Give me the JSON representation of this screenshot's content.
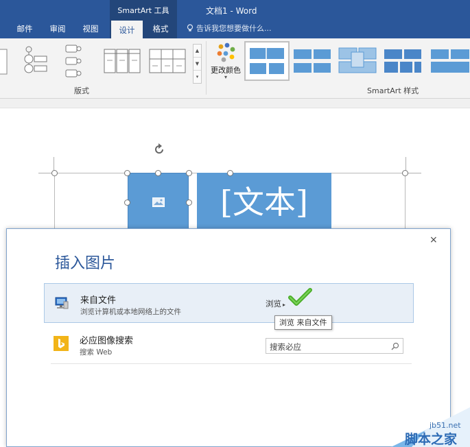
{
  "titlebar": {
    "context_group_title": "SmartArt 工具",
    "window_title": "文档1 - Word",
    "tabs": [
      {
        "label": "邮件",
        "active": false
      },
      {
        "label": "审阅",
        "active": false
      },
      {
        "label": "视图",
        "active": false
      },
      {
        "label": "设计",
        "active": true
      },
      {
        "label": "格式",
        "active": false
      }
    ],
    "tell_me": "告诉我您想要做什么..."
  },
  "ribbon": {
    "layouts_group_label": "版式",
    "change_colors_label": "更改颜色",
    "styles_group_label": "SmartArt 样式",
    "gallery_scroll": [
      "▲",
      "▼",
      "▾"
    ]
  },
  "document": {
    "smartart_text": "[文本]"
  },
  "dialog": {
    "title": "插入图片",
    "close": "×",
    "rows": [
      {
        "title": "来自文件",
        "subtitle": "浏览计算机或本地网络上的文件",
        "action": "浏览",
        "caret": "▸"
      },
      {
        "title": "必应图像搜索",
        "subtitle": "搜索 Web",
        "search_placeholder": "搜索必应"
      }
    ],
    "tooltip": "浏览 来自文件"
  },
  "watermark": {
    "url": "jb51.net",
    "text": "脚本之家"
  },
  "colors": {
    "title_bar": "#2b579a",
    "context_group": "#23467a",
    "smartart_fill": "#5b9bd5",
    "bing_yellow": "#f2b418",
    "check_green": "#4caf2a"
  }
}
